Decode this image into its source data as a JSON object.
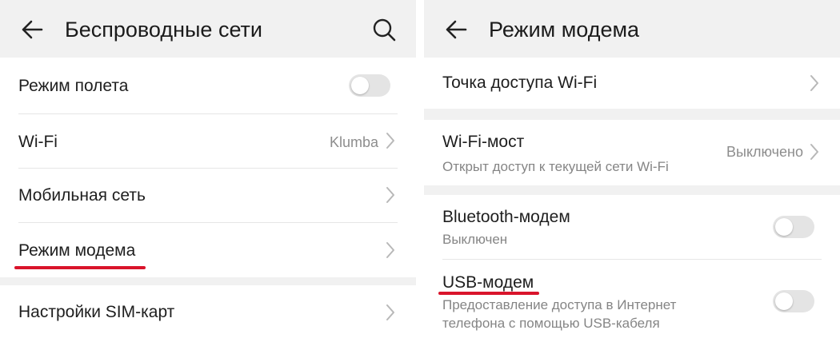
{
  "colors": {
    "underline": "#d9142b",
    "toggle_off": "#e4e4e4",
    "panel_bg": "#f1f1f1"
  },
  "left": {
    "title": "Беспроводные сети",
    "icons": {
      "back": "back-arrow-icon",
      "search": "search-icon"
    },
    "items": [
      {
        "label": "Режим полета",
        "toggle": "off"
      },
      {
        "label": "Wi-Fi",
        "value": "Klumba"
      },
      {
        "label": "Мобильная сеть"
      },
      {
        "label": "Режим модема",
        "highlighted": true
      },
      {
        "label": "Настройки SIM-карт"
      }
    ]
  },
  "right": {
    "title": "Режим модема",
    "icons": {
      "back": "back-arrow-icon"
    },
    "items": [
      {
        "label": "Точка доступа Wi-Fi"
      },
      {
        "label": "Wi-Fi-мост",
        "sublabel": "Открыт доступ к текущей сети Wi-Fi",
        "value": "Выключено"
      },
      {
        "label": "Bluetooth-модем",
        "sublabel": "Выключен",
        "toggle": "off"
      },
      {
        "label": "USB-модем",
        "sublabel_line1": "Предоставление доступа в Интернет",
        "sublabel_line2": "телефона с помощью USB-кабеля",
        "toggle": "off",
        "highlighted": true
      }
    ]
  }
}
